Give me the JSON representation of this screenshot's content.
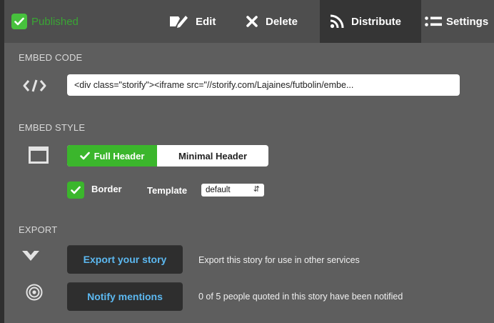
{
  "toolbar": {
    "published_label": "Published",
    "edit_label": "Edit",
    "delete_label": "Delete",
    "distribute_label": "Distribute",
    "settings_label": "Settings"
  },
  "embed_code": {
    "title": "EMBED CODE",
    "value": "<div class=\"storify\"><iframe src=\"//storify.com/Lajaines/futbolin/embe..."
  },
  "embed_style": {
    "title": "EMBED STYLE",
    "options": [
      "Full Header",
      "Minimal Header"
    ],
    "selected": "Full Header",
    "border_label": "Border",
    "border_checked": true,
    "template_label": "Template",
    "template_value": "default"
  },
  "export": {
    "title": "EXPORT",
    "export_button": "Export your story",
    "export_desc": "Export this story for use in other services",
    "notify_button": "Notify mentions",
    "notify_desc": "0 of 5 people quoted in this story have been notified"
  },
  "colors": {
    "accent_green": "#3bb62c",
    "link_blue": "#5cb8f0",
    "panel_bg": "#5e5e5e"
  }
}
